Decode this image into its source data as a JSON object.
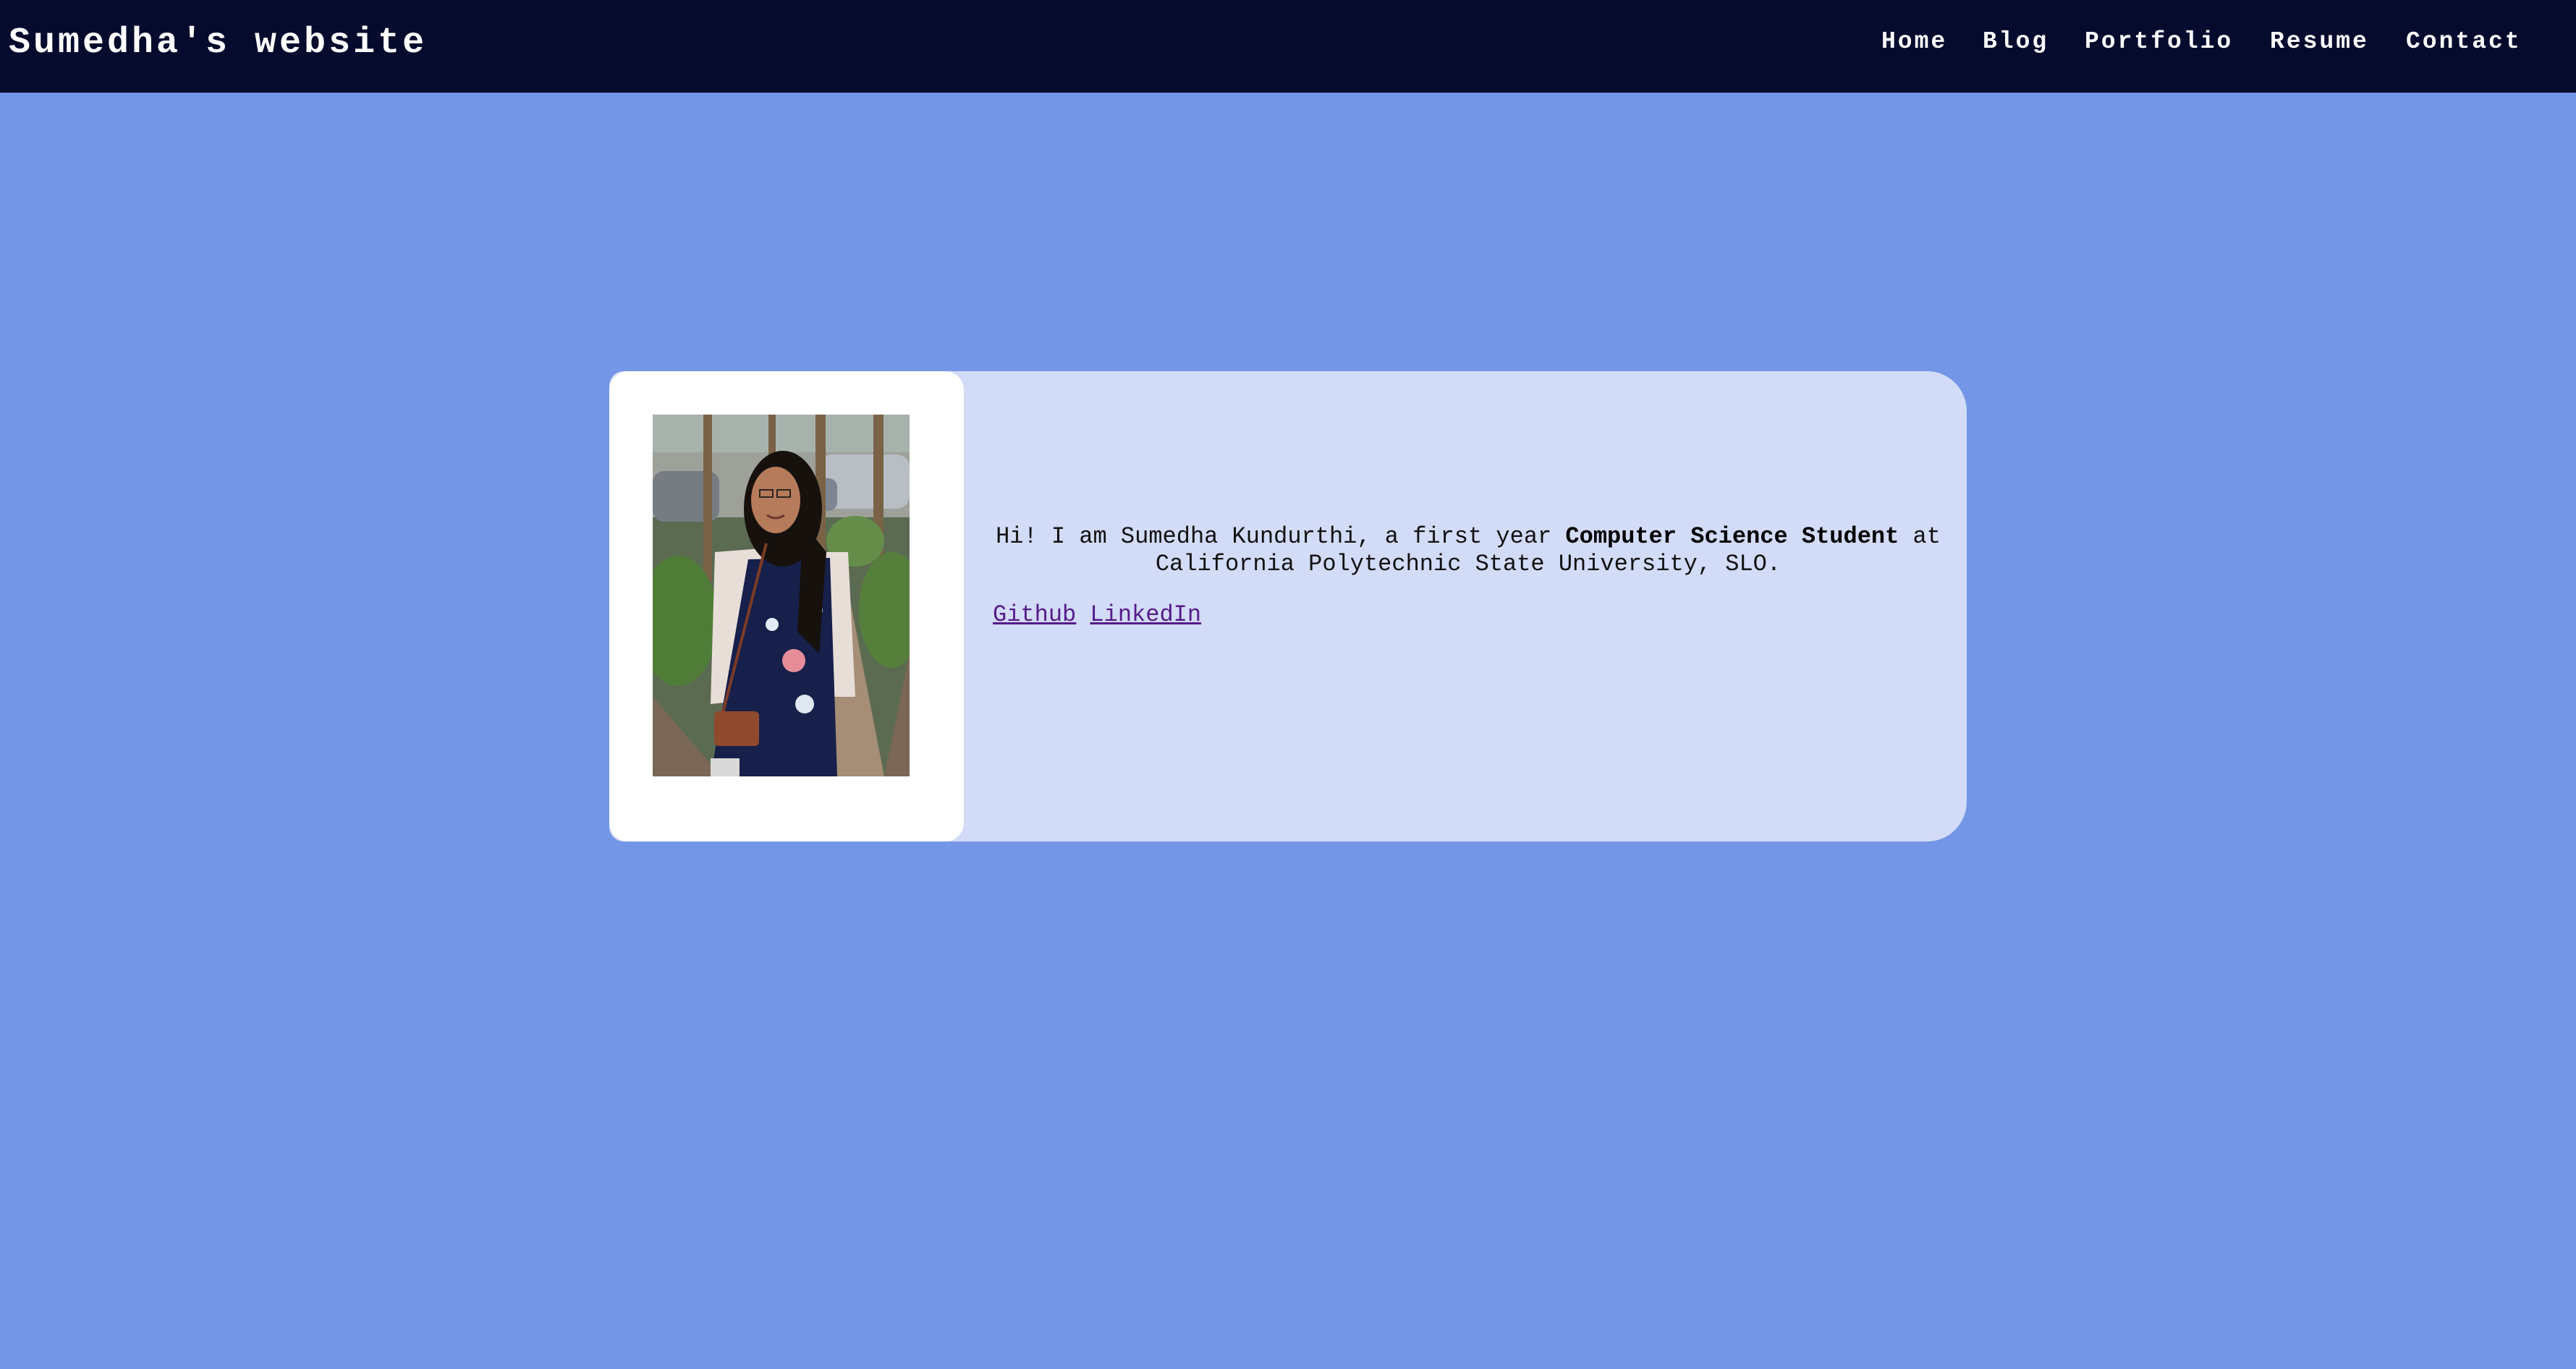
{
  "site": {
    "title": "Sumedha's website"
  },
  "nav": {
    "items": [
      {
        "label": "Home"
      },
      {
        "label": "Blog"
      },
      {
        "label": "Portfolio"
      },
      {
        "label": "Resume"
      },
      {
        "label": "Contact"
      }
    ]
  },
  "intro": {
    "prefix": "Hi! I am Sumedha Kundurthi, a first year ",
    "emphasis": "Computer Science Student",
    "suffix": " at California Polytechnic State University, SLO."
  },
  "links": {
    "github": "Github",
    "linkedin": "LinkedIn"
  },
  "colors": {
    "page_background": "#7396e6",
    "navbar_background": "#040b2d",
    "card_background": "#d2dbf7",
    "photo_panel_background": "#ffffff",
    "link_visited": "#551a8b"
  }
}
